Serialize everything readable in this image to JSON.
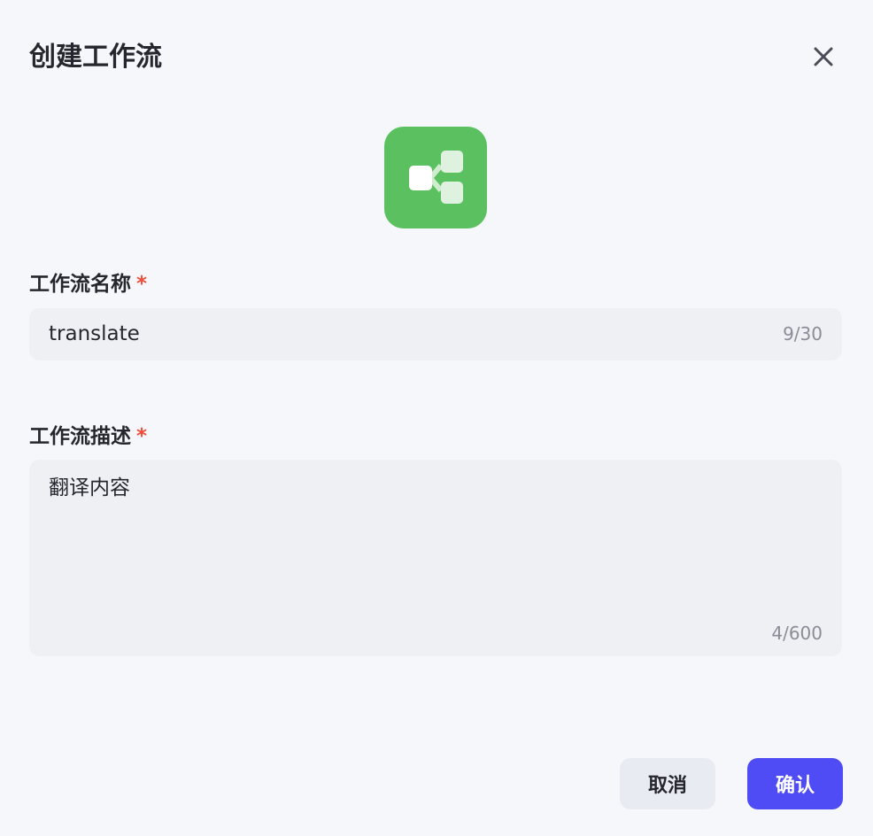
{
  "dialog": {
    "title": "创建工作流",
    "close_icon": "close-icon",
    "app_icon": "workflow-icon",
    "app_icon_color": "#5ac060"
  },
  "name_field": {
    "label": "工作流名称",
    "required_mark": "*",
    "value": "translate",
    "counter": "9/30"
  },
  "description_field": {
    "label": "工作流描述",
    "required_mark": "*",
    "value": "翻译内容",
    "counter": "4/600"
  },
  "footer": {
    "cancel_label": "取消",
    "confirm_label": "确认",
    "confirm_color": "#4f4bf5"
  }
}
